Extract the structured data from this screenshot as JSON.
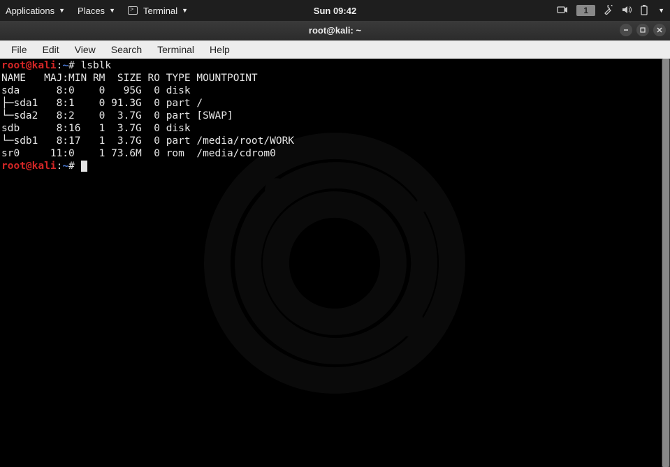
{
  "topbar": {
    "applications": "Applications",
    "places": "Places",
    "terminal_label": "Terminal",
    "clock": "Sun 09:42",
    "workspace": "1"
  },
  "window": {
    "title": "root@kali: ~"
  },
  "menubar": {
    "file": "File",
    "edit": "Edit",
    "view": "View",
    "search": "Search",
    "terminal": "Terminal",
    "help": "Help"
  },
  "terminal": {
    "prompt_user": "root@kali",
    "prompt_colon": ":",
    "prompt_path": "~",
    "prompt_hash": "#",
    "cmd1": " lsblk",
    "header": "NAME   MAJ:MIN RM  SIZE RO TYPE MOUNTPOINT",
    "rows": [
      "sda      8:0    0   95G  0 disk ",
      "├─sda1   8:1    0 91.3G  0 part /",
      "└─sda2   8:2    0  3.7G  0 part [SWAP]",
      "sdb      8:16   1  3.7G  0 disk ",
      "└─sdb1   8:17   1  3.7G  0 part /media/root/WORK",
      "sr0     11:0    1 73.6M  0 rom  /media/cdrom0"
    ]
  }
}
